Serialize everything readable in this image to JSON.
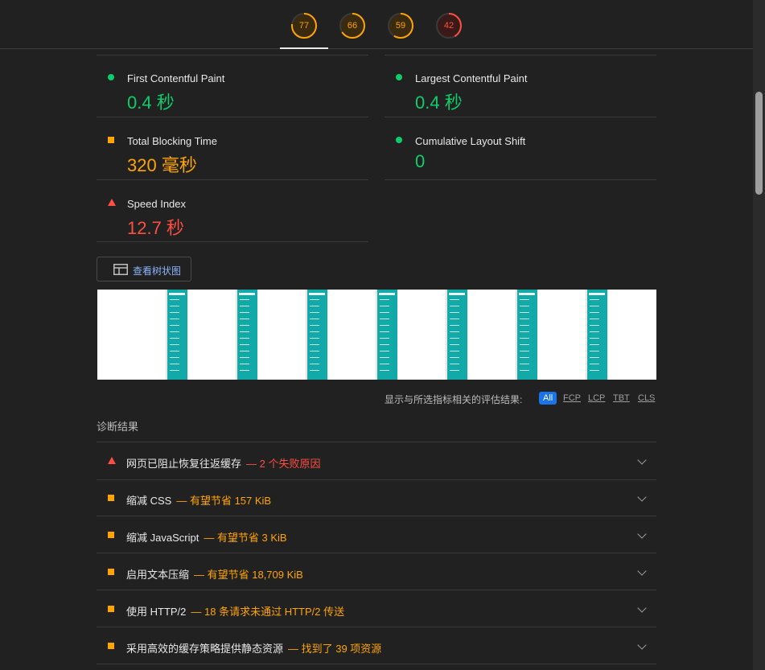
{
  "scores": [
    {
      "value": "77",
      "level": "average",
      "color": "#ffa400",
      "fraction": 0.77
    },
    {
      "value": "66",
      "level": "average",
      "color": "#ffa400",
      "fraction": 0.66
    },
    {
      "value": "59",
      "level": "average",
      "color": "#ffa400",
      "fraction": 0.59
    },
    {
      "value": "42",
      "level": "fail",
      "color": "#ff4e42",
      "fraction": 0.42
    }
  ],
  "metrics": [
    {
      "title": "First Contentful Paint",
      "value": "0.4 秒",
      "status": "pass",
      "icon": "circle-icon"
    },
    {
      "title": "Largest Contentful Paint",
      "value": "0.4 秒",
      "status": "pass",
      "icon": "circle-icon"
    },
    {
      "title": "Total Blocking Time",
      "value": "320 毫秒",
      "status": "average",
      "icon": "square-icon"
    },
    {
      "title": "Cumulative Layout Shift",
      "value": "0",
      "status": "pass",
      "icon": "circle-icon"
    },
    {
      "title": "Speed Index",
      "value": "12.7 秒",
      "status": "fail",
      "icon": "triangle-icon"
    }
  ],
  "treemap_button": {
    "label": "查看树状图",
    "icon": "treemap-icon"
  },
  "filter": {
    "label": "显示与所选指标相关的评估结果:",
    "chips": [
      "All",
      "FCP",
      "LCP",
      "TBT",
      "CLS"
    ],
    "active": "All"
  },
  "diagnostics_title": "诊断结果",
  "audits": [
    {
      "title": "网页已阻止恢复往返缓存",
      "detail": "— 2 个失败原因",
      "status": "fail"
    },
    {
      "title": "缩减 CSS",
      "detail": "— 有望节省 157 KiB",
      "status": "average"
    },
    {
      "title": "缩减 JavaScript",
      "detail": "— 有望节省 3 KiB",
      "status": "average"
    },
    {
      "title": "启用文本压缩",
      "detail": "— 有望节省 18,709 KiB",
      "status": "average"
    },
    {
      "title": "使用 HTTP/2",
      "detail": "— 18 条请求未通过 HTTP/2 传送",
      "status": "average"
    },
    {
      "title": "采用高效的缓存策略提供静态资源",
      "detail": "— 找到了 39 项资源",
      "status": "average"
    }
  ],
  "colors": {
    "pass": "#0cce6b",
    "average": "#ffa400",
    "fail": "#ff4e42",
    "link": "#8ab4f8",
    "accent": "#1a73e8"
  }
}
